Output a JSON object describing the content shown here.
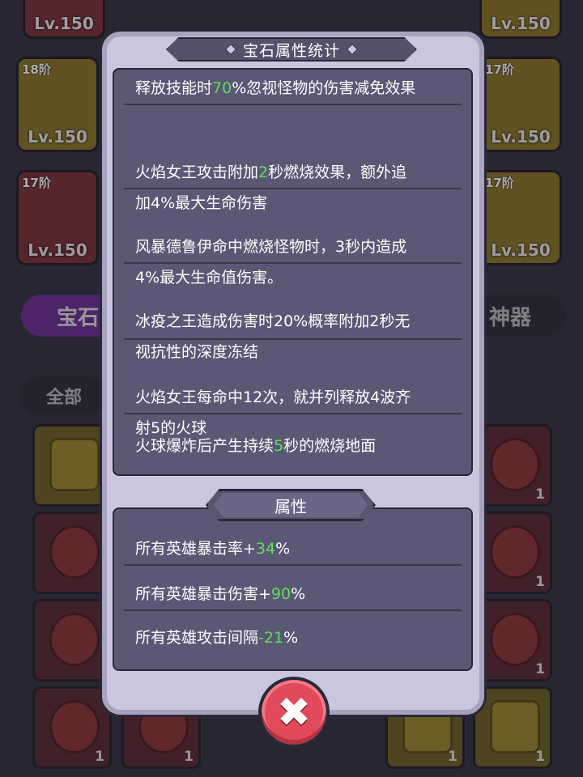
{
  "background": {
    "top_cards": [
      {
        "tier": "",
        "level": "Lv.150",
        "color": "red"
      },
      {
        "tier": "",
        "level": "Lv.150",
        "color": "gold"
      },
      {
        "tier": "18阶",
        "level": "Lv.150",
        "color": "gold"
      },
      {
        "tier": "17阶",
        "level": "Lv.150",
        "color": "gold"
      },
      {
        "tier": "17阶",
        "level": "Lv.150",
        "color": "red"
      },
      {
        "tier": "17阶",
        "level": "Lv.150",
        "color": "gold"
      }
    ],
    "tab_gem": "宝石",
    "tab_artifact": "神器",
    "filter_all": "全部",
    "gem_count": "1"
  },
  "modal": {
    "title": "宝石属性统计",
    "effects": [
      {
        "pre": "释放技能时",
        "hl": "70",
        "post": "%忽视怪物的伤害减免效果"
      },
      {
        "pre": "火焰女王攻击附加",
        "hl": "2",
        "post": "秒燃烧效果，额外追\n加4%最大生命伤害"
      },
      {
        "pre": "风暴德鲁伊命中燃烧怪物时，3秒内造成\n4%最大生命值伤害。",
        "hl": "",
        "post": ""
      },
      {
        "pre": "冰疫之王造成伤害时20%概率附加2秒无\n视抗性的深度冻结",
        "hl": "",
        "post": ""
      },
      {
        "pre": "火焰女王每命中12次，就并列释放4波齐\n射5的火球",
        "hl": "",
        "post": ""
      },
      {
        "pre": "火球爆炸后产生持续",
        "hl": "5",
        "post": "秒的燃烧地面"
      }
    ],
    "attr_title": "属性",
    "attributes": [
      {
        "pre": "所有英雄暴击率+",
        "hl": "34",
        "post": "%"
      },
      {
        "pre": "所有英雄暴击伤害+",
        "hl": "90",
        "post": "%"
      },
      {
        "pre": "所有英雄攻击间隔",
        "hl": "-21",
        "post": "%"
      }
    ],
    "close_icon": "close-x-icon",
    "accent_green": "#5ee05a",
    "close_red": "#e14a5a"
  }
}
